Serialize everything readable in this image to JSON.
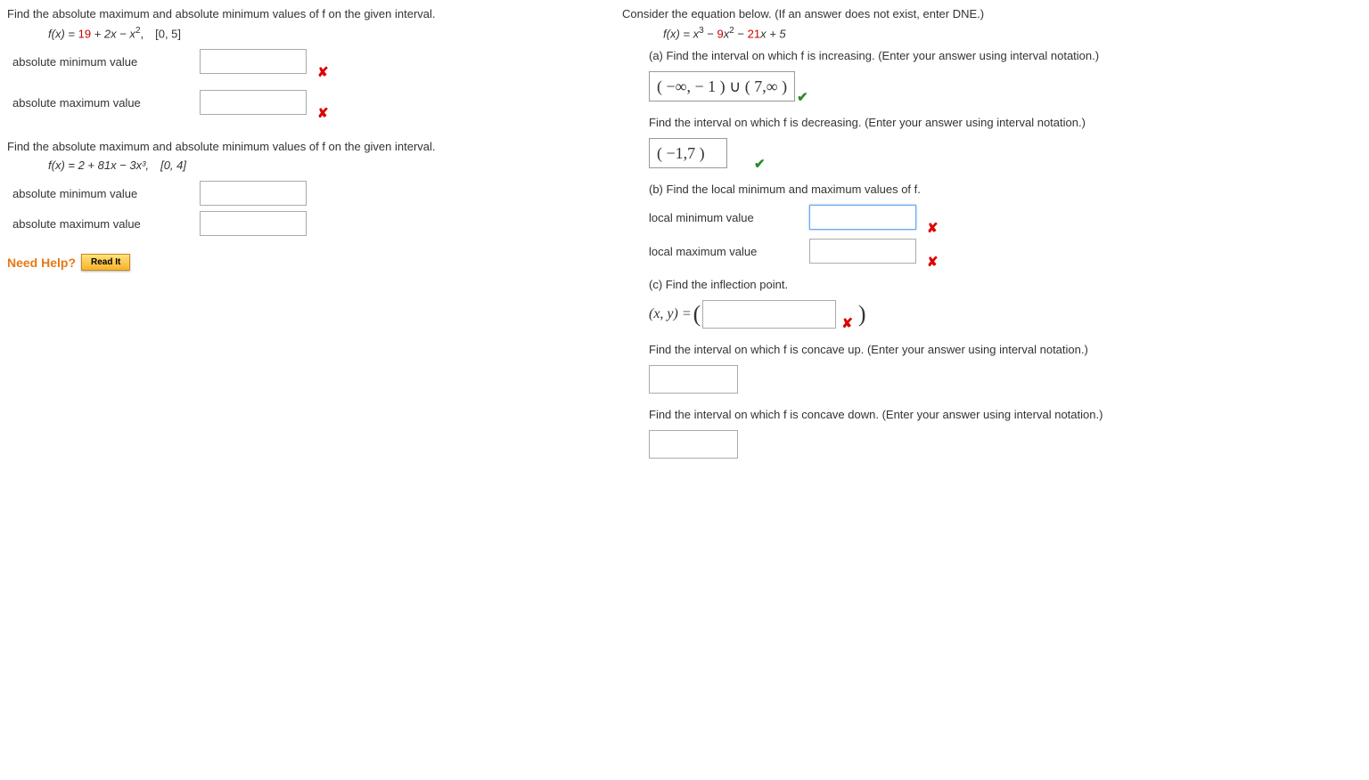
{
  "left": {
    "p1": {
      "prompt": "Find the absolute maximum and absolute minimum values of f on the given interval.",
      "fx_prefix": "f(x) = ",
      "fx_red": "19",
      "fx_mid": " + 2x − x",
      "fx_sup": "2",
      "fx_tail": ", [0, 5]",
      "min_label": "absolute minimum value",
      "max_label": "absolute maximum value"
    },
    "p2": {
      "prompt": "Find the absolute maximum and absolute minimum values of f on the given interval.",
      "fx_full": "f(x) = 2 + 81x − 3x³, [0, 4]",
      "min_label": "absolute minimum value",
      "max_label": "absolute maximum value"
    },
    "help": {
      "need": "Need Help?",
      "read": "Read It"
    }
  },
  "right": {
    "consider": "Consider the equation below. (If an answer does not exist, enter DNE.)",
    "fx_prefix": "f(x) = x",
    "fx_sup1": "3",
    "fx_mid1": " − ",
    "fx_red1": "9",
    "fx_mid2": "x",
    "fx_sup2": "2",
    "fx_mid3": " − ",
    "fx_red2": "21",
    "fx_tail": "x + 5",
    "a_prompt": "(a) Find the interval on which f is increasing. (Enter your answer using interval notation.)",
    "a_ans": "( −∞, − 1 ) ∪ ( 7,∞ )",
    "a2_prompt": "Find the interval on which f is decreasing. (Enter your answer using interval notation.)",
    "a2_ans": "( −1,7 )",
    "b_prompt": "(b) Find the local minimum and maximum values of f.",
    "b_min_label": "local minimum value",
    "b_max_label": "local maximum value",
    "c_prompt": "(c) Find the inflection point.",
    "xy_label": "(x, y) = ",
    "c2_prompt": "Find the interval on which f is concave up. (Enter your answer using interval notation.)",
    "c3_prompt": "Find the interval on which f is concave down. (Enter your answer using interval notation.)"
  }
}
